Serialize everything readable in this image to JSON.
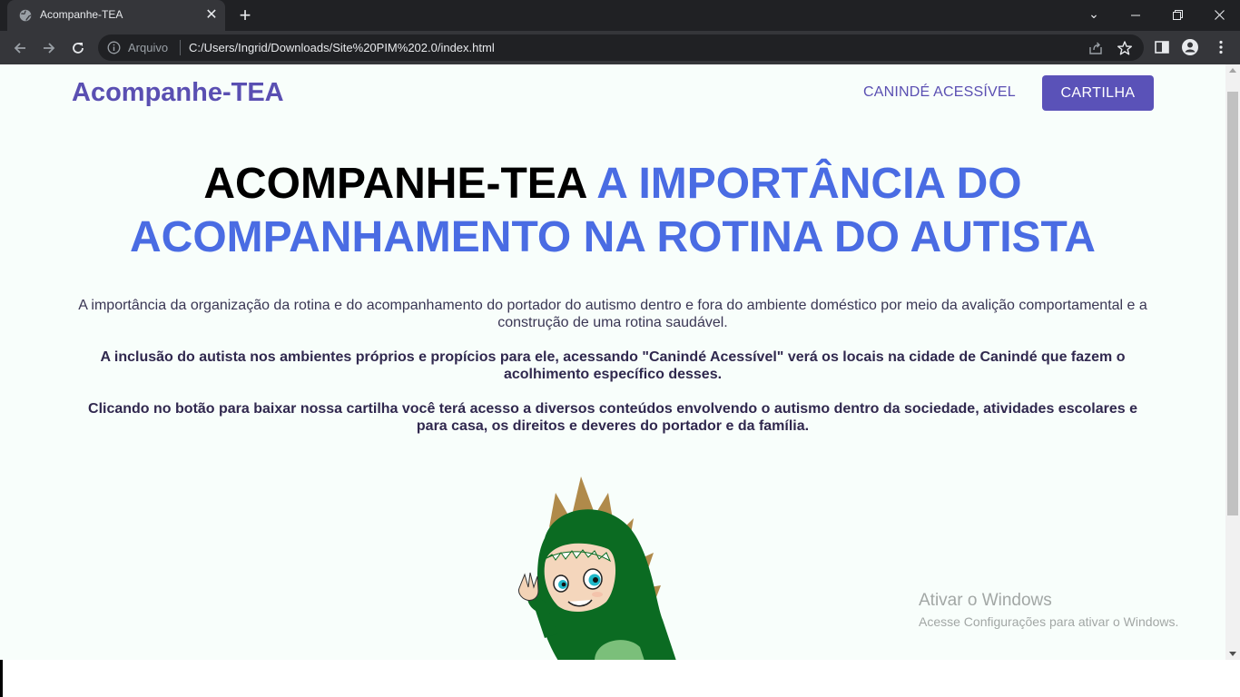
{
  "browser": {
    "tab_title": "Acompanhe-TEA",
    "scheme_label": "Arquivo",
    "url": "C:/Users/Ingrid/Downloads/Site%20PIM%202.0/index.html"
  },
  "page": {
    "logo": "Acompanhe-TEA",
    "nav": {
      "link_label": "CANINDÉ ACESSÍVEL",
      "cta_label": "CARTILHA"
    },
    "hero": {
      "title_dark": "ACOMPANHE-TEA",
      "title_accent": "A IMPORTÂNCIA DO ACOMPANHAMENTO NA ROTINA DO AUTISTA"
    },
    "paragraphs": [
      "A importância da organização da rotina e do acompanhamento do portador do autismo dentro e fora do ambiente doméstico por meio da avalição comportamental e a construção de uma rotina saudável.",
      "A inclusão do autista nos ambientes próprios e propícios para ele, acessando \"Canindé Acessível\" verá os locais na cidade de Canindé que fazem o acolhimento específico desses.",
      "Clicando no botão para baixar nossa cartilha você terá acesso a diversos conteúdos envolvendo o autismo dentro da sociedade, atividades escolares e para casa, os direitos e deveres do portador e da família."
    ],
    "colors": {
      "brand": "#5a4fb2",
      "accent": "#4a6ce3",
      "background": "#f8fefb"
    }
  },
  "os_watermark": {
    "title": "Ativar o Windows",
    "subtitle": "Acesse Configurações para ativar o Windows."
  },
  "icons": {
    "tab_favicon": "globe-icon",
    "info": "info-icon",
    "share": "share-icon",
    "bookmark": "star-icon",
    "side_panel": "side-panel-icon",
    "profile": "profile-icon",
    "menu": "kebab-menu-icon"
  }
}
